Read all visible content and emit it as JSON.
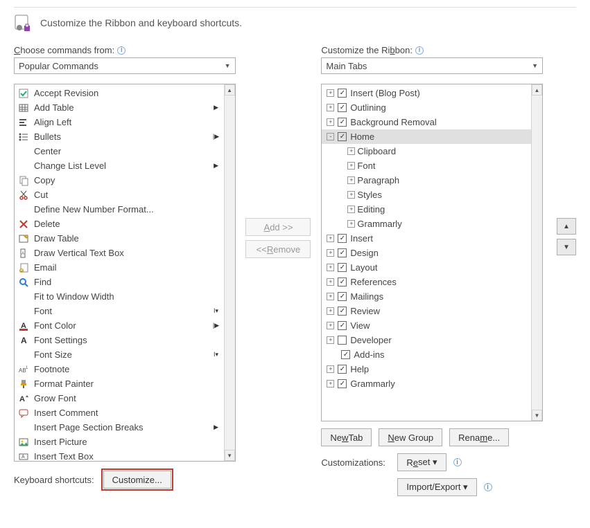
{
  "header_title": "Customize the Ribbon and keyboard shortcuts.",
  "left": {
    "label": "Choose commands from:",
    "dropdown": "Popular Commands",
    "commands": [
      {
        "icon": "accept",
        "label": "Accept Revision",
        "sub": ""
      },
      {
        "icon": "table",
        "label": "Add Table",
        "sub": "▶"
      },
      {
        "icon": "align-left",
        "label": "Align Left",
        "sub": ""
      },
      {
        "icon": "bullets",
        "label": "Bullets",
        "sub": "|▶"
      },
      {
        "icon": "",
        "label": "Center",
        "sub": ""
      },
      {
        "icon": "",
        "label": "Change List Level",
        "sub": "▶"
      },
      {
        "icon": "copy",
        "label": "Copy",
        "sub": ""
      },
      {
        "icon": "cut",
        "label": "Cut",
        "sub": ""
      },
      {
        "icon": "",
        "label": "Define New Number Format...",
        "sub": ""
      },
      {
        "icon": "delete",
        "label": "Delete",
        "sub": ""
      },
      {
        "icon": "draw-table",
        "label": "Draw Table",
        "sub": ""
      },
      {
        "icon": "vtextbox",
        "label": "Draw Vertical Text Box",
        "sub": ""
      },
      {
        "icon": "email",
        "label": "Email",
        "sub": ""
      },
      {
        "icon": "find",
        "label": "Find",
        "sub": ""
      },
      {
        "icon": "",
        "label": "Fit to Window Width",
        "sub": ""
      },
      {
        "icon": "",
        "label": "Font",
        "sub": "I▾"
      },
      {
        "icon": "font-color",
        "label": "Font Color",
        "sub": "|▶"
      },
      {
        "icon": "font-settings",
        "label": "Font Settings",
        "sub": ""
      },
      {
        "icon": "",
        "label": "Font Size",
        "sub": "I▾"
      },
      {
        "icon": "footnote",
        "label": "Footnote",
        "sub": ""
      },
      {
        "icon": "format-painter",
        "label": "Format Painter",
        "sub": ""
      },
      {
        "icon": "grow-font",
        "label": "Grow Font",
        "sub": ""
      },
      {
        "icon": "comment",
        "label": "Insert Comment",
        "sub": ""
      },
      {
        "icon": "",
        "label": "Insert Page  Section Breaks",
        "sub": "▶"
      },
      {
        "icon": "picture",
        "label": "Insert Picture",
        "sub": ""
      },
      {
        "icon": "textbox",
        "label": "Insert Text Box",
        "sub": ""
      }
    ]
  },
  "middle": {
    "add": "Add >>",
    "remove": "<< Remove"
  },
  "right": {
    "label": "Customize the Ribbon:",
    "dropdown": "Main Tabs",
    "tree": [
      {
        "depth": 0,
        "exp": "+",
        "chk": true,
        "label": "Insert (Blog Post)"
      },
      {
        "depth": 0,
        "exp": "+",
        "chk": true,
        "label": "Outlining"
      },
      {
        "depth": 0,
        "exp": "+",
        "chk": true,
        "label": "Background Removal"
      },
      {
        "depth": 0,
        "exp": "-",
        "chk": true,
        "label": "Home",
        "selected": true
      },
      {
        "depth": 1,
        "exp": "+",
        "chk": null,
        "label": "Clipboard"
      },
      {
        "depth": 1,
        "exp": "+",
        "chk": null,
        "label": "Font"
      },
      {
        "depth": 1,
        "exp": "+",
        "chk": null,
        "label": "Paragraph"
      },
      {
        "depth": 1,
        "exp": "+",
        "chk": null,
        "label": "Styles"
      },
      {
        "depth": 1,
        "exp": "+",
        "chk": null,
        "label": "Editing"
      },
      {
        "depth": 1,
        "exp": "+",
        "chk": null,
        "label": "Grammarly"
      },
      {
        "depth": 0,
        "exp": "+",
        "chk": true,
        "label": "Insert"
      },
      {
        "depth": 0,
        "exp": "+",
        "chk": true,
        "label": "Design"
      },
      {
        "depth": 0,
        "exp": "+",
        "chk": true,
        "label": "Layout"
      },
      {
        "depth": 0,
        "exp": "+",
        "chk": true,
        "label": "References"
      },
      {
        "depth": 0,
        "exp": "+",
        "chk": true,
        "label": "Mailings"
      },
      {
        "depth": 0,
        "exp": "+",
        "chk": true,
        "label": "Review"
      },
      {
        "depth": 0,
        "exp": "+",
        "chk": true,
        "label": "View"
      },
      {
        "depth": 0,
        "exp": "+",
        "chk": false,
        "label": "Developer"
      },
      {
        "depth": 0,
        "exp": " ",
        "chk": true,
        "label": "Add-ins"
      },
      {
        "depth": 0,
        "exp": "+",
        "chk": true,
        "label": "Help"
      },
      {
        "depth": 0,
        "exp": "+",
        "chk": true,
        "label": "Grammarly"
      }
    ],
    "buttons": {
      "newtab": "New Tab",
      "newgroup": "New Group",
      "rename": "Rename..."
    },
    "cust_label": "Customizations:",
    "reset": "Reset ▾",
    "importexport": "Import/Export ▾"
  },
  "kb": {
    "label": "Keyboard shortcuts:",
    "button": "Customize..."
  }
}
